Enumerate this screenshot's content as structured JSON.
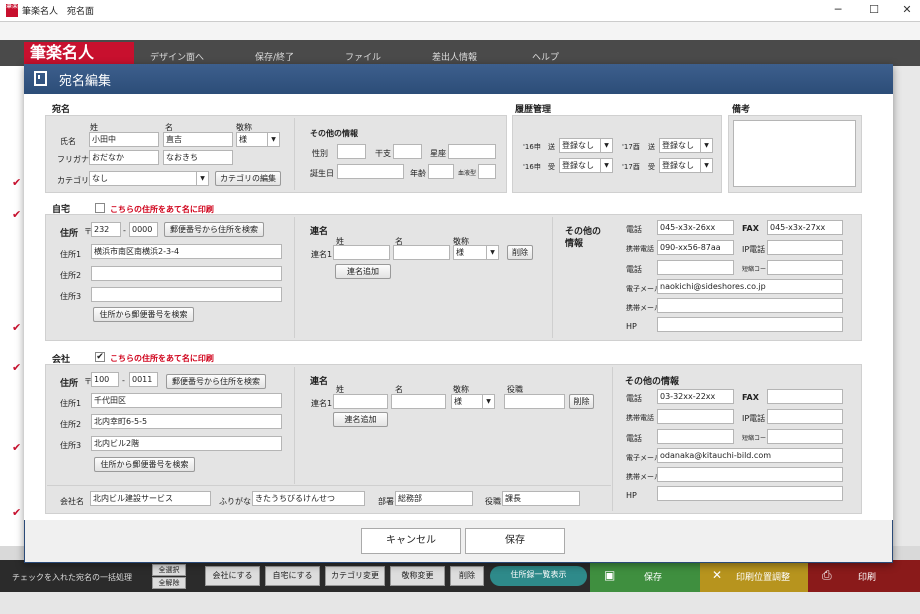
{
  "window": {
    "title": "筆楽名人　宛名面",
    "minimize": "─",
    "maximize": "☐",
    "close": "✕",
    "icon_text": "筆楽"
  },
  "app": {
    "logo": "筆楽名人",
    "menu": [
      "デザイン面へ",
      "保存/終了",
      "ファイル",
      "差出人情報",
      "ヘルプ"
    ]
  },
  "dialog": {
    "title": "宛名編集",
    "atena": {
      "heading": "宛名",
      "sei_label": "姓",
      "mei_label": "名",
      "keisho_label": "敬称",
      "name_label": "氏名",
      "sei": "小田中",
      "mei": "直吉",
      "keisho": "様",
      "furigana_label": "フリガナ",
      "furi_sei": "おだなか",
      "furi_mei": "なおきち",
      "category_label": "カテゴリ",
      "category": "なし",
      "category_edit": "カテゴリの編集",
      "other": {
        "heading": "その他の情報",
        "gender": "性別",
        "eto": "干支",
        "seiza": "星座",
        "birthday": "誕生日",
        "age": "年齢",
        "blood": "血液型"
      }
    },
    "history": {
      "heading": "履歴管理",
      "rows": [
        {
          "year": "'16申",
          "dir": "送",
          "val": "登録なし"
        },
        {
          "year": "'17酉",
          "dir": "送",
          "val": "登録なし"
        },
        {
          "year": "'16申",
          "dir": "受",
          "val": "登録なし"
        },
        {
          "year": "'17酉",
          "dir": "受",
          "val": "登録なし"
        }
      ]
    },
    "memo": {
      "heading": "備考"
    },
    "home": {
      "heading": "自宅",
      "print_label": "こちらの住所をあて名に印刷",
      "zip_label": "住所",
      "zip_mark": "〒",
      "zip1": "232",
      "zip_sep": "-",
      "zip2": "0000",
      "zip_search": "郵便番号から住所を検索",
      "addr1_label": "住所1",
      "addr1": "横浜市南区南横浜2-3-4",
      "addr2_label": "住所2",
      "addr2": "",
      "addr3_label": "住所3",
      "addr3": "",
      "addr_search": "住所から郵便番号を検索",
      "renmei": {
        "heading": "連名",
        "sei_label": "姓",
        "mei_label": "名",
        "keisho_label": "敬称",
        "row_label": "連名1",
        "keisho": "様",
        "delete": "削除",
        "add": "連名追加"
      },
      "other": {
        "heading": "その他の",
        "heading2": "情報",
        "tel_label": "電話",
        "tel": "045-x3x-26xx",
        "fax_label": "FAX",
        "fax": "045-x3x-27xx",
        "mobile_label": "携帯電話",
        "mobile": "090-xx56-87aa",
        "ip_label": "IP電話",
        "tel2_label": "電話",
        "code_label": "短縮コード",
        "email_label": "電子メール",
        "email": "naokichi@sideshores.co.jp",
        "mmail_label": "携帯メール",
        "hp_label": "HP"
      }
    },
    "company": {
      "heading": "会社",
      "print_label": "こちらの住所をあて名に印刷",
      "zip_label": "住所",
      "zip_mark": "〒",
      "zip1": "100",
      "zip_sep": "-",
      "zip2": "0011",
      "zip_search": "郵便番号から住所を検索",
      "addr1_label": "住所1",
      "addr1": "千代田区",
      "addr2_label": "住所2",
      "addr2": "北内幸町6-5-5",
      "addr3_label": "住所3",
      "addr3": "北内ビル2階",
      "addr_search": "住所から郵便番号を検索",
      "renmei": {
        "heading": "連名",
        "sei_label": "姓",
        "mei_label": "名",
        "keisho_label": "敬称",
        "yaku_label": "役職",
        "row_label": "連名1",
        "keisho": "様",
        "delete": "削除",
        "add": "連名追加"
      },
      "other": {
        "heading": "その他の情報",
        "tel_label": "電話",
        "tel": "03-32xx-22xx",
        "fax_label": "FAX",
        "mobile_label": "携帯電話",
        "ip_label": "IP電話",
        "tel2_label": "電話",
        "code_label": "短縮コード",
        "email_label": "電子メール",
        "email": "odanaka@kitauchi-bild.com",
        "mmail_label": "携帯メール",
        "hp_label": "HP"
      },
      "name_label": "会社名",
      "name": "北内ビル建設サービス",
      "furi_label": "ふりがな",
      "furi": "きたうちびるけんせつ",
      "dept_label": "部署",
      "dept": "総務部",
      "title_label": "役職",
      "title": "課長"
    },
    "cancel": "キャンセル",
    "save": "保存"
  },
  "bottom": {
    "bulk_label": "チェックを入れた宛名の一括処理",
    "select_all": "全選択",
    "deselect_all": "全解除",
    "buttons": [
      "会社にする",
      "自宅にする",
      "カテゴリ変更",
      "敬称変更",
      "削除"
    ],
    "list_view": "住所録一覧表示",
    "save": "保存",
    "print_pos": "印刷位置調整",
    "print": "印刷"
  },
  "colors": {
    "accent_red": "#d0021b",
    "header_blue": "#2c4d78"
  }
}
